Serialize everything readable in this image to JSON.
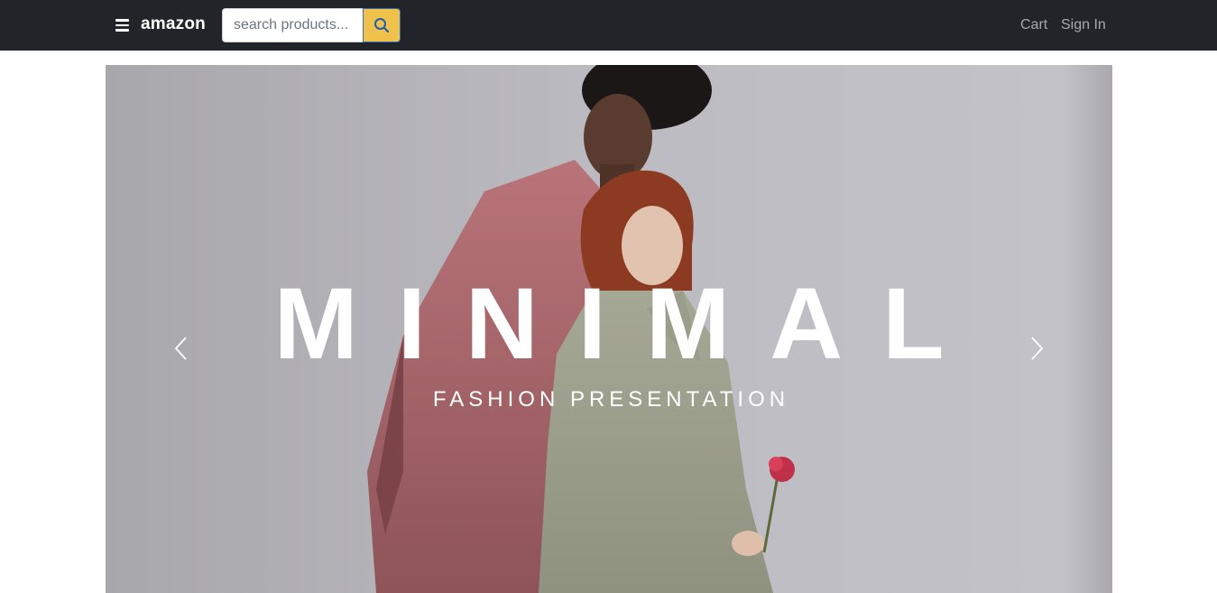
{
  "navbar": {
    "brand": "amazon",
    "menu_icon": "hamburger-menu-icon",
    "search": {
      "placeholder": "search products...",
      "value": "",
      "button_icon": "search-icon"
    },
    "links": {
      "cart": "Cart",
      "sign_in": "Sign In"
    }
  },
  "carousel": {
    "slide": {
      "title": "MINIMAL",
      "subtitle": "FASHION PRESENTATION"
    },
    "prev_icon": "chevron-left-icon",
    "next_icon": "chevron-right-icon"
  },
  "colors": {
    "navbar_bg": "#212529",
    "search_button": "#f0c14b",
    "nav_link": "rgba(255,255,255,0.6)",
    "slide_bg": "#b9b8bd"
  }
}
